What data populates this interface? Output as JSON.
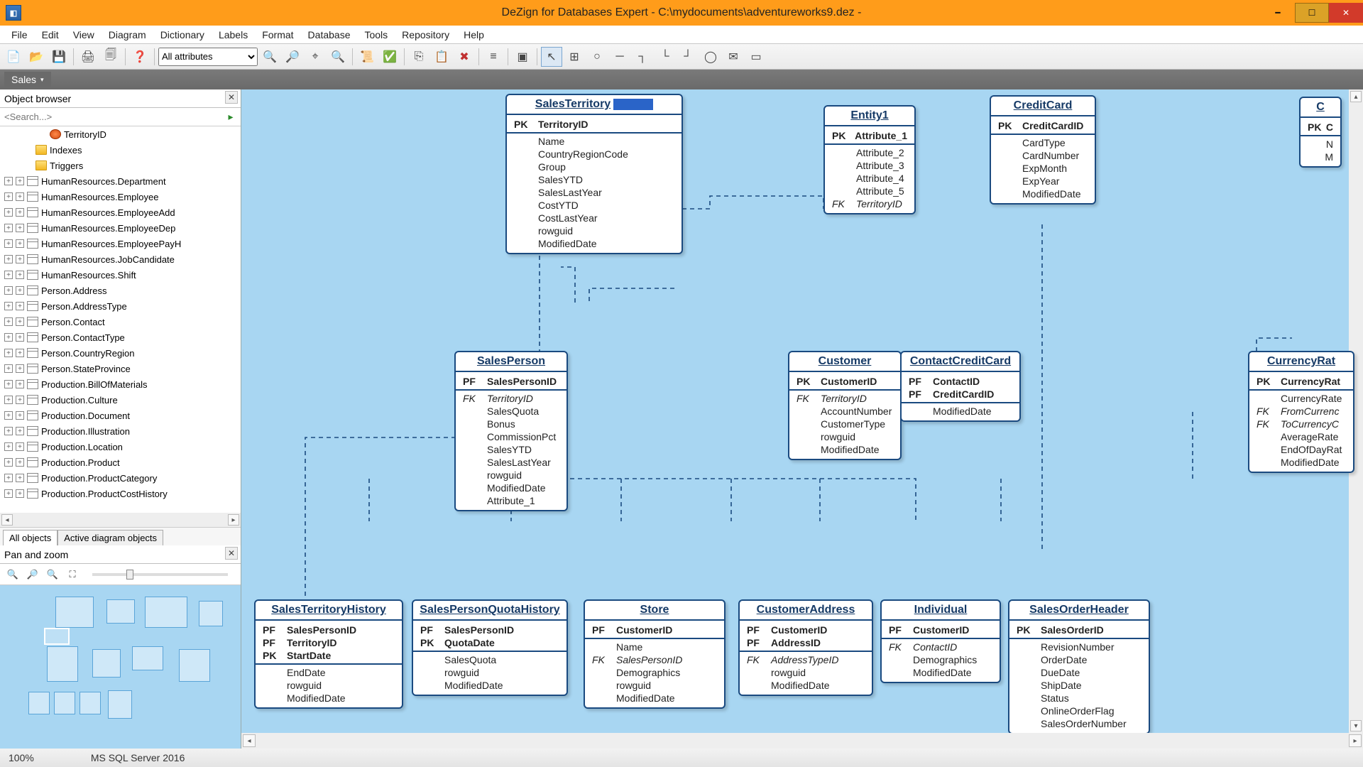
{
  "window": {
    "title": "DeZign for Databases Expert - C:\\mydocuments\\adventureworks9.dez -"
  },
  "menu": [
    "File",
    "Edit",
    "View",
    "Diagram",
    "Dictionary",
    "Labels",
    "Format",
    "Database",
    "Tools",
    "Repository",
    "Help"
  ],
  "toolbar": {
    "attr_filter": "All attributes"
  },
  "tab": {
    "name": "Sales"
  },
  "object_browser": {
    "title": "Object browser",
    "search_placeholder": "<Search...>",
    "top_items": [
      {
        "type": "col",
        "indent": 70,
        "label": "TerritoryID"
      },
      {
        "type": "folder",
        "indent": 50,
        "label": "Indexes"
      },
      {
        "type": "folder",
        "indent": 50,
        "label": "Triggers"
      }
    ],
    "tables": [
      "HumanResources.Department",
      "HumanResources.Employee",
      "HumanResources.EmployeeAdd",
      "HumanResources.EmployeeDep",
      "HumanResources.EmployeePayH",
      "HumanResources.JobCandidate",
      "HumanResources.Shift",
      "Person.Address",
      "Person.AddressType",
      "Person.Contact",
      "Person.ContactType",
      "Person.CountryRegion",
      "Person.StateProvince",
      "Production.BillOfMaterials",
      "Production.Culture",
      "Production.Document",
      "Production.Illustration",
      "Production.Location",
      "Production.Product",
      "Production.ProductCategory",
      "Production.ProductCostHistory"
    ],
    "bottom_tabs": [
      "All objects",
      "Active diagram objects"
    ]
  },
  "pan_zoom": {
    "title": "Pan and zoom"
  },
  "status": {
    "zoom": "100%",
    "db": "MS SQL Server 2016"
  },
  "entities": {
    "SalesTerritory": {
      "title": "SalesTerritory",
      "selected": true,
      "rows": [
        [
          "PK",
          "TerritoryID"
        ],
        [
          "",
          "Name"
        ],
        [
          "",
          "CountryRegionCode"
        ],
        [
          "",
          "Group"
        ],
        [
          "",
          "SalesYTD"
        ],
        [
          "",
          "SalesLastYear"
        ],
        [
          "",
          "CostYTD"
        ],
        [
          "",
          "CostLastYear"
        ],
        [
          "",
          "rowguid"
        ],
        [
          "",
          "ModifiedDate"
        ]
      ]
    },
    "Entity1": {
      "title": "Entity1",
      "rows": [
        [
          "PK",
          "Attribute_1"
        ],
        [
          "",
          "Attribute_2"
        ],
        [
          "",
          "Attribute_3"
        ],
        [
          "",
          "Attribute_4"
        ],
        [
          "",
          "Attribute_5"
        ],
        [
          "FK",
          "TerritoryID"
        ]
      ]
    },
    "CreditCard": {
      "title": "CreditCard",
      "rows": [
        [
          "PK",
          "CreditCardID"
        ],
        [
          "",
          "CardType"
        ],
        [
          "",
          "CardNumber"
        ],
        [
          "",
          "ExpMonth"
        ],
        [
          "",
          "ExpYear"
        ],
        [
          "",
          "ModifiedDate"
        ]
      ]
    },
    "c_partial": {
      "title": "C",
      "rows": [
        [
          "PK",
          "C"
        ],
        [
          "",
          "N"
        ],
        [
          "",
          "M"
        ]
      ]
    },
    "SalesPerson": {
      "title": "SalesPerson",
      "rows": [
        [
          "PF",
          "SalesPersonID"
        ],
        [
          "FK",
          "TerritoryID"
        ],
        [
          "",
          "SalesQuota"
        ],
        [
          "",
          "Bonus"
        ],
        [
          "",
          "CommissionPct"
        ],
        [
          "",
          "SalesYTD"
        ],
        [
          "",
          "SalesLastYear"
        ],
        [
          "",
          "rowguid"
        ],
        [
          "",
          "ModifiedDate"
        ],
        [
          "",
          "Attribute_1"
        ]
      ]
    },
    "Customer": {
      "title": "Customer",
      "rows": [
        [
          "PK",
          "CustomerID"
        ],
        [
          "FK",
          "TerritoryID"
        ],
        [
          "",
          "AccountNumber"
        ],
        [
          "",
          "CustomerType"
        ],
        [
          "",
          "rowguid"
        ],
        [
          "",
          "ModifiedDate"
        ]
      ]
    },
    "ContactCreditCard": {
      "title": "ContactCreditCard",
      "rows": [
        [
          "PF",
          "ContactID"
        ],
        [
          "PF",
          "CreditCardID"
        ],
        [
          "",
          "ModifiedDate"
        ]
      ]
    },
    "CurrencyRate": {
      "title": "CurrencyRat",
      "rows": [
        [
          "PK",
          "CurrencyRat"
        ],
        [
          "",
          "CurrencyRate"
        ],
        [
          "FK",
          "FromCurrenc"
        ],
        [
          "FK",
          "ToCurrencyC"
        ],
        [
          "",
          "AverageRate"
        ],
        [
          "",
          "EndOfDayRat"
        ],
        [
          "",
          "ModifiedDate"
        ]
      ]
    },
    "SalesTerritoryHistory": {
      "title": "SalesTerritoryHistory",
      "rows": [
        [
          "PF",
          "SalesPersonID"
        ],
        [
          "PF",
          "TerritoryID"
        ],
        [
          "PK",
          "StartDate"
        ],
        [
          "",
          "EndDate"
        ],
        [
          "",
          "rowguid"
        ],
        [
          "",
          "ModifiedDate"
        ]
      ]
    },
    "SalesPersonQuotaHistory": {
      "title": "SalesPersonQuotaHistory",
      "rows": [
        [
          "PF",
          "SalesPersonID"
        ],
        [
          "PK",
          "QuotaDate"
        ],
        [
          "",
          "SalesQuota"
        ],
        [
          "",
          "rowguid"
        ],
        [
          "",
          "ModifiedDate"
        ]
      ]
    },
    "Store": {
      "title": "Store",
      "rows": [
        [
          "PF",
          "CustomerID"
        ],
        [
          "",
          "Name"
        ],
        [
          "FK",
          "SalesPersonID"
        ],
        [
          "",
          "Demographics"
        ],
        [
          "",
          "rowguid"
        ],
        [
          "",
          "ModifiedDate"
        ]
      ]
    },
    "CustomerAddress": {
      "title": "CustomerAddress",
      "rows": [
        [
          "PF",
          "CustomerID"
        ],
        [
          "PF",
          "AddressID"
        ],
        [
          "FK",
          "AddressTypeID"
        ],
        [
          "",
          "rowguid"
        ],
        [
          "",
          "ModifiedDate"
        ]
      ]
    },
    "Individual": {
      "title": "Individual",
      "rows": [
        [
          "PF",
          "CustomerID"
        ],
        [
          "FK",
          "ContactID"
        ],
        [
          "",
          "Demographics"
        ],
        [
          "",
          "ModifiedDate"
        ]
      ]
    },
    "SalesOrderHeader": {
      "title": "SalesOrderHeader",
      "rows": [
        [
          "PK",
          "SalesOrderID"
        ],
        [
          "",
          "RevisionNumber"
        ],
        [
          "",
          "OrderDate"
        ],
        [
          "",
          "DueDate"
        ],
        [
          "",
          "ShipDate"
        ],
        [
          "",
          "Status"
        ],
        [
          "",
          "OnlineOrderFlag"
        ],
        [
          "",
          "SalesOrderNumber"
        ]
      ]
    }
  }
}
